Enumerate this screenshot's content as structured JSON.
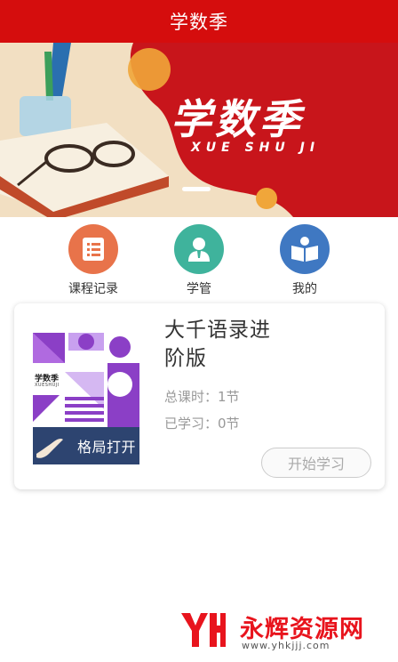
{
  "header": {
    "title": "学数季"
  },
  "banner": {
    "title": "学数季",
    "subtitle": "XUE SHU JI",
    "carousel_indicator": "1"
  },
  "nav": {
    "items": [
      {
        "label": "课程记录",
        "icon": "list-icon",
        "color": "#e8734a"
      },
      {
        "label": "学管",
        "icon": "person-icon",
        "color": "#3fb39c"
      },
      {
        "label": "我的",
        "icon": "book-reader-icon",
        "color": "#3f78c2"
      }
    ]
  },
  "course": {
    "title": "大千语录进阶版",
    "cover": {
      "brand": "学数季",
      "brand_sub": "XUESHUJI",
      "caption": "格局打开"
    },
    "total_lessons": "总课时：1节",
    "learned_lessons": "已学习：0节",
    "start_button": "开始学习"
  },
  "watermark": {
    "text": "永辉资源网",
    "url": "www.yhkjjj.com"
  },
  "colors": {
    "header_bg": "#d50d0d",
    "banner_red": "#c8151b",
    "cover_purple": "#8b3fc6",
    "cover_strip": "#2d4470"
  }
}
